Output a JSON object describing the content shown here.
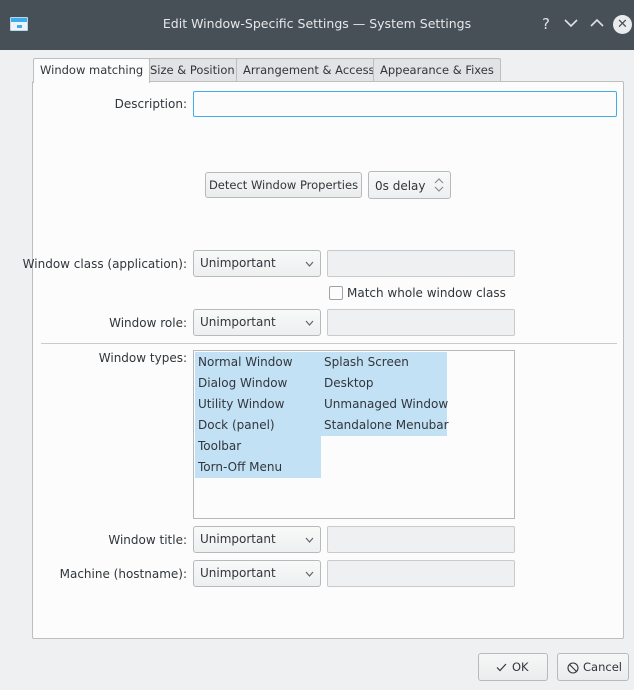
{
  "window": {
    "title": "Edit Window-Specific Settings — System Settings",
    "help_label": "?",
    "close_glyph": "✕"
  },
  "tabs": [
    {
      "label": "Window matching",
      "active": true
    },
    {
      "label": "Size & Position",
      "active": false
    },
    {
      "label": "Arrangement & Access",
      "active": false
    },
    {
      "label": "Appearance & Fixes",
      "active": false
    }
  ],
  "form": {
    "description_label": "Description:",
    "description_value": "",
    "detect_button": "Detect Window Properties",
    "delay_value": "0s delay",
    "window_class_label": "Window class (application):",
    "window_class_combo": "Unimportant",
    "window_class_value": "",
    "match_whole_label": "Match whole window class",
    "match_whole_checked": false,
    "window_role_label": "Window role:",
    "window_role_combo": "Unimportant",
    "window_role_value": "",
    "window_types_label": "Window types:",
    "window_types": [
      "Normal Window",
      "Dialog Window",
      "Utility Window",
      "Dock (panel)",
      "Toolbar",
      "Torn-Off Menu",
      "Splash Screen",
      "Desktop",
      "Unmanaged Window",
      "Standalone Menubar"
    ],
    "window_title_label": "Window title:",
    "window_title_combo": "Unimportant",
    "window_title_value": "",
    "machine_label": "Machine (hostname):",
    "machine_combo": "Unimportant",
    "machine_value": ""
  },
  "footer": {
    "ok_label": "OK",
    "cancel_label": "Cancel"
  },
  "colors": {
    "titlebar": "#475057",
    "accent": "#3daee9",
    "selection": "#c3e1f5",
    "background": "#eff0f1"
  }
}
